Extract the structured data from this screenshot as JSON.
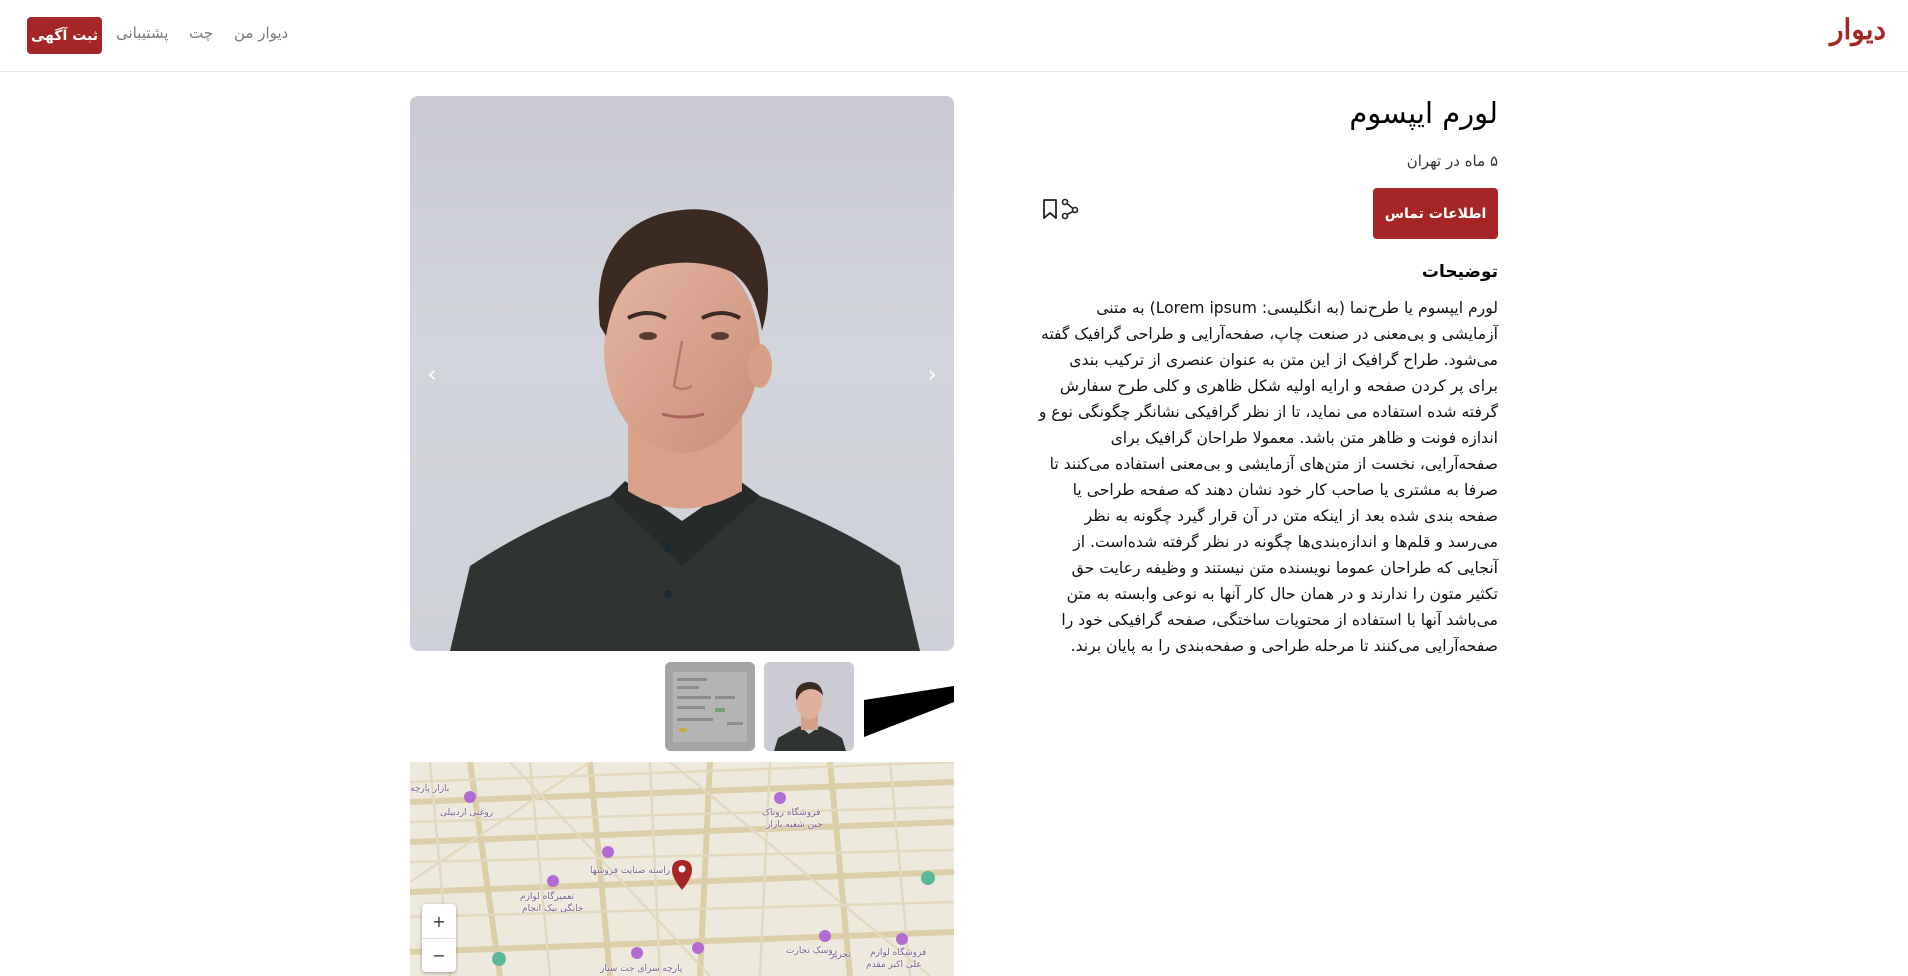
{
  "header": {
    "logo": "دیوار",
    "post_button": "ثبت آگهی",
    "nav": {
      "support": "پشتیبانی",
      "chat": "چت",
      "my_divar": "دیوار من"
    }
  },
  "gallery": {
    "prev_icon": "chevron-left-icon",
    "next_icon": "chevron-right-icon",
    "prev_glyph": "‹",
    "next_glyph": "›",
    "thumbnails": [
      "screenshot-thumbnail",
      "person-thumbnail",
      "black-shape-thumbnail"
    ]
  },
  "map": {
    "zoom_in": "+",
    "zoom_out": "−",
    "labels": [
      "بازار پارچه",
      "روغنی اردبیلی",
      "فروشگاه روناک",
      "جین شعبه بازار",
      "راسته صنایت فروشها",
      "تعمیرگاه لوازم",
      "خانگی بیک انجام",
      "فروشگاه لوازم",
      "تجریر",
      "علی اکبر مقدم",
      "روسک تجارت",
      "پارچه سرای جت ستار"
    ]
  },
  "listing": {
    "title": "لورم ایپسوم",
    "subtitle": "۵ ماه در تهران",
    "contact_button": "اطلاعات تماس",
    "bookmark_icon": "bookmark-icon",
    "share_icon": "share-icon",
    "description_heading": "توضیحات",
    "description": "لورم ایپسوم یا طرح‌نما (به انگلیسی: Lorem ipsum) به متنی آزمایشی و بی‌معنی در صنعت چاپ، صفحه‌آرایی و طراحی گرافیک گفته می‌شود. طراح گرافیک از این متن به عنوان عنصری از ترکیب بندی برای پر کردن صفحه و ارایه اولیه شکل ظاهری و کلی طرح سفارش گرفته شده استفاده می نماید، تا از نظر گرافیکی نشانگر چگونگی نوع و اندازه فونت و ظاهر متن باشد. معمولا طراحان گرافیک برای صفحه‌آرایی، نخست از متن‌های آزمایشی و بی‌معنی استفاده می‌کنند تا صرفا به مشتری یا صاحب کار خود نشان دهند که صفحه طراحی یا صفحه بندی شده بعد از اینکه متن در آن قرار گیرد چگونه به نظر می‌رسد و قلم‌ها و اندازه‌بندی‌ها چگونه در نظر گرفته شده‌است. از آنجایی که طراحان عموما نویسنده متن نیستند و وظیفه رعایت حق تکثیر متون را ندارند و در همان حال کار آنها به نوعی وابسته به متن می‌باشد آنها با استفاده از محتویات ساختگی، صفحه گرافیکی خود را صفحه‌آرایی می‌کنند تا مرحله طراحی و صفحه‌بندی را به پایان برند."
  },
  "colors": {
    "brand": "#a62626",
    "nav_text": "#7a7a7a",
    "map_bg": "#ede9dc",
    "map_road": "#dccfa8",
    "poi": "#b36bd4"
  }
}
